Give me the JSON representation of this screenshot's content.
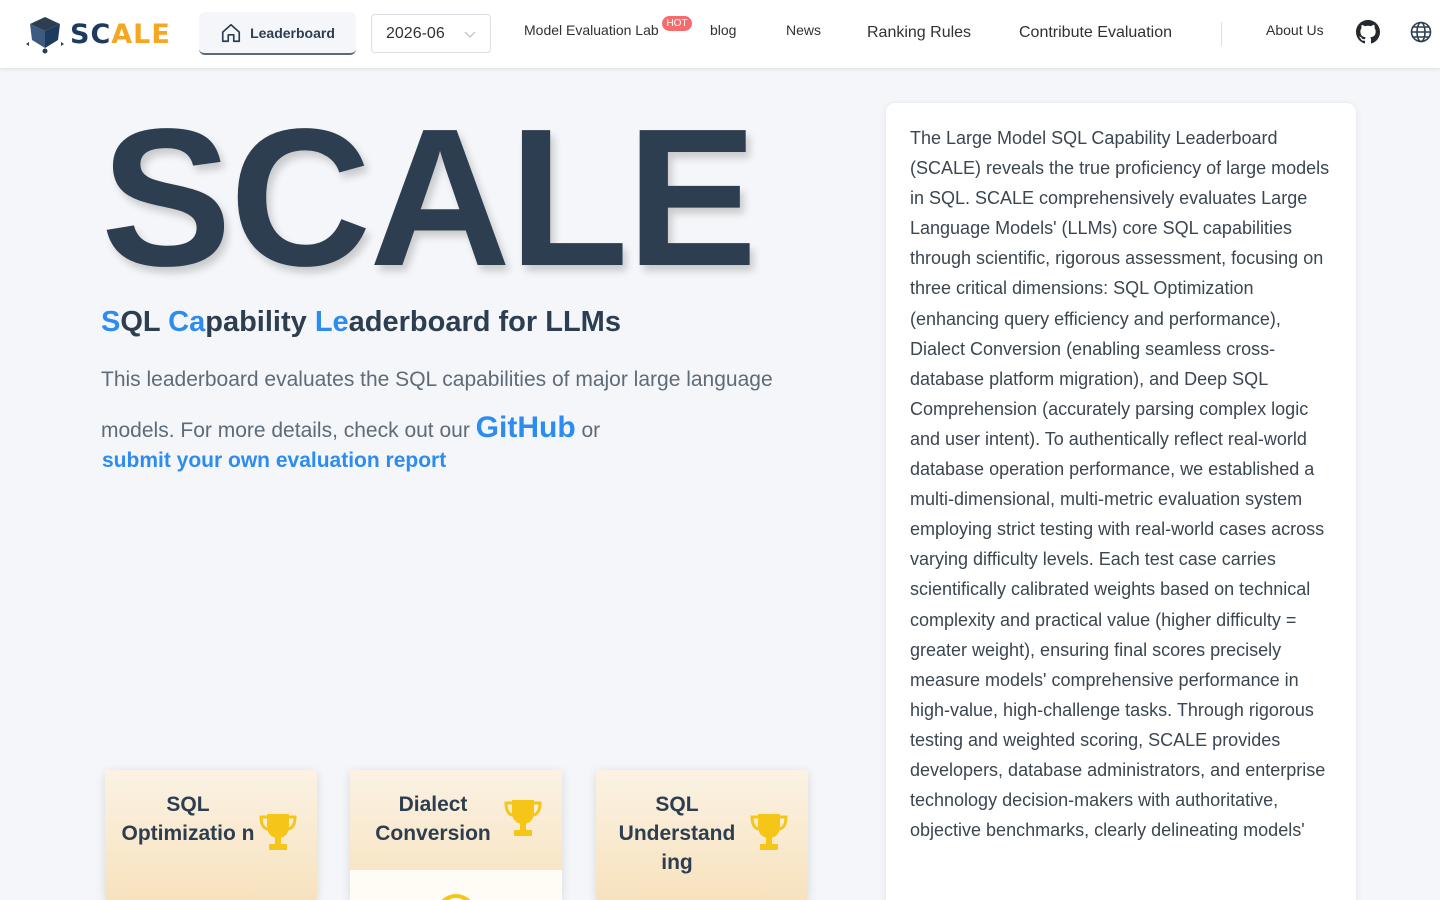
{
  "brand": {
    "name_part1": "SC",
    "name_part2": "A",
    "name_part3": "LE"
  },
  "nav": {
    "leaderboard": "Leaderboard",
    "date_selected": "2026-06",
    "model_lab": "Model Evaluation Lab",
    "hot_badge": "HOT",
    "blog": "blog",
    "news": "News",
    "ranking_rules": "Ranking Rules",
    "contribute": "Contribute Evaluation",
    "about": "About Us"
  },
  "hero": {
    "title": "SCALE",
    "subtitle": {
      "s": "S",
      "ql": "QL ",
      "ca": "Ca",
      "pability": "pability ",
      "le": "Le",
      "aderboard": "aderboard for LLMs"
    },
    "desc_part1": "This leaderboard evaluates the SQL capabilities of major large language models. For more details, check out our ",
    "github_link": "GitHub",
    "desc_part2": " or",
    "submit_link": "submit your own evaluation report"
  },
  "cards": [
    {
      "title": "SQL Optimizatio n"
    },
    {
      "title": "Dialect Conversion"
    },
    {
      "title": "SQL Understand ing"
    }
  ],
  "panel": {
    "text": "The Large Model SQL Capability Leaderboard (SCALE) reveals the true proficiency of large models in SQL. SCALE comprehensively evaluates Large Language Models' (LLMs) core SQL capabilities through scientific, rigorous assessment, focusing on three critical dimensions: SQL Optimization (enhancing query efficiency and performance), Dialect Conversion (enabling seamless cross-database platform migration), and Deep SQL Comprehension (accurately parsing complex logic and user intent). To authentically reflect real-world database operation performance, we established a multi-dimensional, multi-metric evaluation system employing strict testing with real-world cases across varying difficulty levels. Each test case carries scientifically calibrated weights based on technical complexity and practical value (higher difficulty = greater weight), ensuring final scores precisely measure models' comprehensive performance in high-value, high-challenge tasks. Through rigorous testing and weighted scoring, SCALE provides developers, database administrators, and enterprise technology decision-makers with authoritative, objective benchmarks, clearly delineating models'"
  },
  "colors": {
    "accent": "#2d8cf0",
    "brand_orange": "#f5a623",
    "dark": "#2c3e50",
    "hot": "#f56c6c",
    "trophy": "#f5c518"
  },
  "icons": [
    "cube-logo-icon",
    "home-icon",
    "chevron-down-icon",
    "github-icon",
    "globe-icon",
    "trophy-icon"
  ]
}
